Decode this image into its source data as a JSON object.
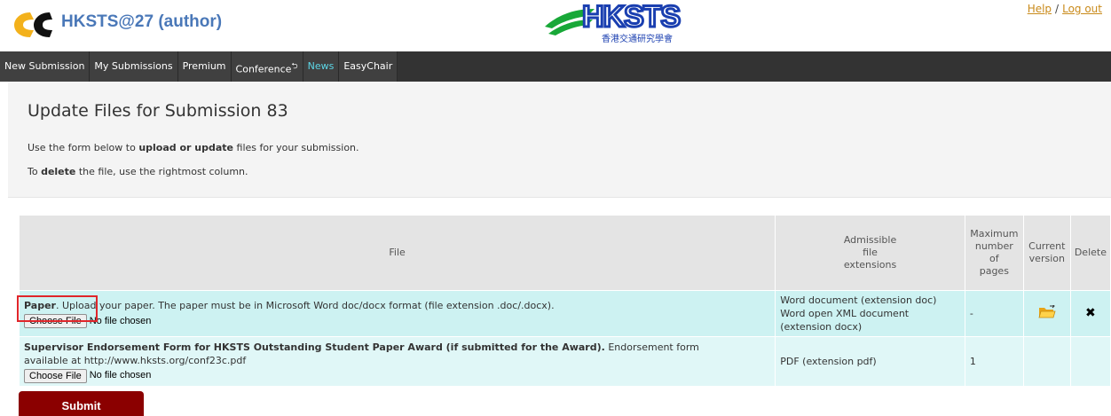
{
  "header": {
    "app_title": "HKSTS@27 (author)",
    "help_label": "Help",
    "separator": "/",
    "logout_label": "Log out",
    "logo_text": "HKSTS",
    "logo_subtext": "香港交通研究學會"
  },
  "nav": {
    "items": [
      {
        "label": "New Submission"
      },
      {
        "label": "My Submissions"
      },
      {
        "label": "Premium"
      },
      {
        "label": "Conference",
        "badge": "⮌"
      },
      {
        "label": "News"
      },
      {
        "label": "EasyChair"
      }
    ]
  },
  "page": {
    "title": "Update Files for Submission 83",
    "intro1_pre": "Use the form below to ",
    "intro1_bold": "upload or update",
    "intro1_post": " files for your submission.",
    "intro2_pre": "To ",
    "intro2_bold": "delete",
    "intro2_post": " the file, use the rightmost column."
  },
  "table": {
    "headers": {
      "file": "File",
      "ext_1": "Admissible",
      "ext_2": "file",
      "ext_3": "extensions",
      "max_1": "Maximum",
      "max_2": "number",
      "max_3": "of",
      "max_4": "pages",
      "cur_1": "Current",
      "cur_2": "version",
      "delete": "Delete"
    },
    "rows": [
      {
        "title": "Paper",
        "desc": ". Upload your paper. The paper must be in Microsoft Word doc/docx format (file extension .doc/.docx).",
        "ext_1": "Word document (extension doc)",
        "ext_2": "Word open XML document",
        "ext_3": "(extension docx)",
        "max_pages": "-"
      },
      {
        "title": "Supervisor Endorsement Form for HKSTS Outstanding Student Paper Award (if submitted for the Award).",
        "desc_1": " Endorsement form",
        "desc_2": "available at http://www.hksts.org/conf23c.pdf",
        "ext_1": "PDF (extension pdf)",
        "max_pages": "1"
      }
    ],
    "choose_file_label": "Choose File",
    "no_file_label": "No file chosen"
  },
  "submit_label": "Submit",
  "colors": {
    "brand_blue": "#4a78b8",
    "nav_bg": "#333333",
    "news_link": "#5cd6e6",
    "row_bg": "#cdf2f2",
    "submit_bg": "#8b0000",
    "highlight": "#e0262b"
  }
}
